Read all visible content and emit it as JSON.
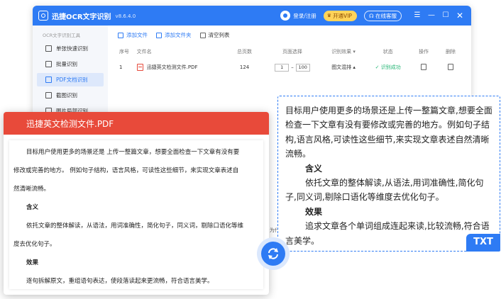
{
  "app": {
    "title": "迅捷OCR文字识别",
    "version": "v8.6.4.0",
    "login": "登录/注册",
    "vip": "开通VIP",
    "customer_service": "在线客服"
  },
  "sidebar": {
    "header": "OCR文字识别工具",
    "items": [
      {
        "label": "单张快速识别",
        "icon": "image-icon"
      },
      {
        "label": "批量识别",
        "icon": "layers-icon"
      },
      {
        "label": "PDF文档识别",
        "icon": "pdf-icon",
        "active": true
      },
      {
        "label": "截图识别",
        "icon": "crop-icon"
      },
      {
        "label": "图片局部识别",
        "icon": "scan-icon"
      }
    ]
  },
  "toolbar": {
    "add_file": "添加文件",
    "add_folder": "添加文件夹",
    "clear_list": "清空列表"
  },
  "table": {
    "headers": [
      "序号",
      "文件名",
      "总页数",
      "页面选择",
      "识别效果",
      "状态",
      "操作",
      "删除"
    ],
    "rows": [
      {
        "no": "1",
        "name": "迅捷英文检测文件.PDF",
        "pages": "124",
        "page_from": "1",
        "page_to": "100",
        "effect": "图文混排",
        "status": "识别成功"
      }
    ]
  },
  "pdf_card": {
    "title": "迅捷英文检测文件.PDF",
    "lines": [
      "目标用户使用更多的场景还是 上传一整篇文章，想要全面检查一下文章有没有要",
      "修改或完善的地方。 例如句子结构，语言风格，可读性这些细节，来实现文章表述自",
      "然清晰流畅。",
      "含义",
      "依托文章的整体解读，从语法，用词准确性，简化句子，同义词，剔除口语化等维",
      "度去优化句子。",
      "效果",
      "逐句拆解原文，重组语句表达，使段落读起来更流畅，符合语言美学。"
    ]
  },
  "txt_card": {
    "paragraph1": "目标用户使用更多的场景还是上传一整篇文章,想要全面检查一下文章有没有要修改或完善的地方。例如句子结构,语言风格,可读性这些细节,来实现文章表述自然清晰流畅。",
    "heading1": "含义",
    "paragraph2": "依托文章的整体解读,从语法,用词准确性,简化句子,同义词,剔除口语化等维度去优化句子。",
    "heading2": "效果",
    "paragraph3": "追求文章各个单词组成连起来读,比较流畅,符合语言美学。",
    "badge": "TXT"
  },
  "peek_text": "为什",
  "colors": {
    "accent": "#2e7bf4",
    "pdf_red": "#e84a3a",
    "success": "#22b573",
    "vip": "#ffd45a"
  }
}
